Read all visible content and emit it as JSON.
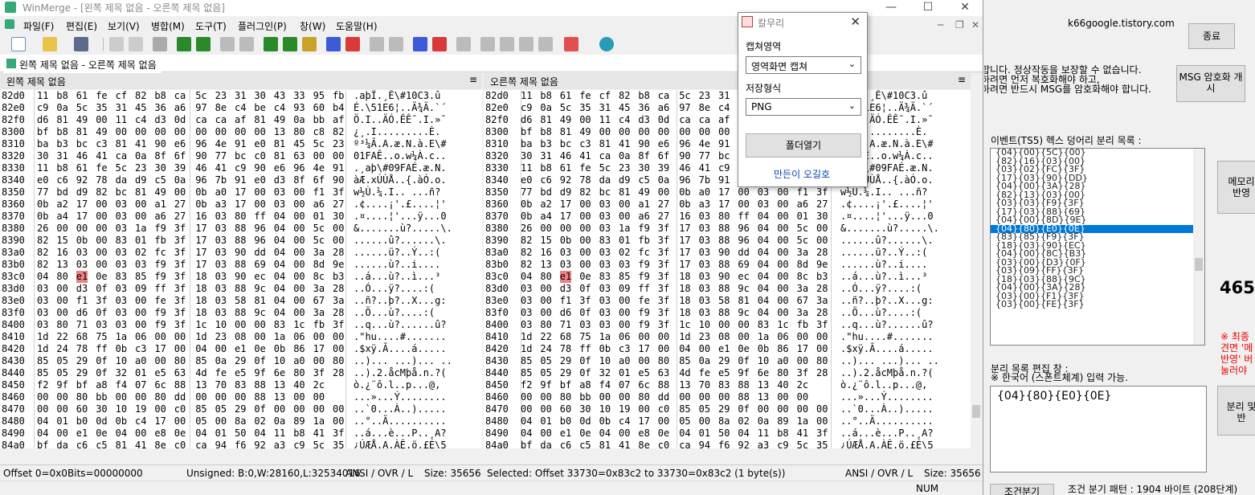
{
  "window": {
    "title": "WinMerge - [왼쪽 제목 없음 - 오른쪽 제목 없음]",
    "controls": [
      "—",
      "☐",
      "✕"
    ]
  },
  "menu": [
    "파일(F)",
    "편집(E)",
    "보기(V)",
    "병합(M)",
    "도구(T)",
    "플러그인(P)",
    "창(W)",
    "도움말(H)"
  ],
  "doc_tab": "왼쪽 제목 없음 - 오른쪽 제목 없음",
  "left_pane": {
    "header": "왼쪽 제목 없음",
    "dots": "≡"
  },
  "right_pane": {
    "header": "오른쪽 제목 없음",
    "dots": "≡"
  },
  "hex_rows": [
    {
      "off": "82d0",
      "bytes": [
        "11",
        "b8",
        "61",
        "fe",
        "cf",
        "82",
        "b8",
        "ca",
        "5c",
        "23",
        "31",
        "30",
        "43",
        "33",
        "95",
        "fb"
      ],
      "ascii": ".aþÏ.¸Ê\\#10C3.û"
    },
    {
      "off": "82e0",
      "bytes": [
        "c9",
        "0a",
        "5c",
        "35",
        "31",
        "45",
        "36",
        "a6",
        "97",
        "8e",
        "c4",
        "be",
        "c4",
        "93",
        "60",
        "b4"
      ],
      "ascii": "É.\\51E6¦..Ä¾Ä.`´"
    },
    {
      "off": "82f0",
      "bytes": [
        "d6",
        "81",
        "49",
        "00",
        "11",
        "c4",
        "d3",
        "0d",
        "ca",
        "ca",
        "af",
        "81",
        "49",
        "0a",
        "bb",
        "af"
      ],
      "ascii": "Ö.I..ÄÓ.ÊÊ¯.I.»¯"
    },
    {
      "off": "8300",
      "bytes": [
        "bf",
        "b8",
        "81",
        "49",
        "00",
        "00",
        "00",
        "00",
        "00",
        "00",
        "00",
        "00",
        "13",
        "80",
        "c8",
        "82"
      ],
      "ascii": "¿¸.I.........È."
    },
    {
      "off": "8310",
      "bays": "",
      "bytes": [
        "ba",
        "b3",
        "bc",
        "c3",
        "81",
        "41",
        "90",
        "e6",
        "96",
        "4e",
        "91",
        "e0",
        "81",
        "45",
        "5c",
        "23"
      ],
      "ascii": "º³¼Ã.A.æ.N.à.E\\#"
    },
    {
      "off": "8320",
      "bytes": [
        "30",
        "31",
        "46",
        "41",
        "ca",
        "0a",
        "8f",
        "6f",
        "90",
        "77",
        "bc",
        "c0",
        "81",
        "63",
        "00",
        "00"
      ],
      "ascii": "01FAÊ..o.w¼À.c.."
    },
    {
      "off": "8330",
      "bytes": [
        "11",
        "b8",
        "61",
        "fe",
        "5c",
        "23",
        "30",
        "39",
        "46",
        "41",
        "c9",
        "90",
        "e6",
        "96",
        "4e",
        "91"
      ],
      "ascii": ".¸aþ\\#09FAÉ.æ.N."
    },
    {
      "off": "8340",
      "bytes": [
        "e0",
        "c6",
        "92",
        "78",
        "da",
        "d9",
        "c5",
        "0a",
        "96",
        "7b",
        "91",
        "e0",
        "d3",
        "8f",
        "6f",
        "90"
      ],
      "ascii": "àÆ.xÚÙÅ..{.àÓ.o."
    },
    {
      "off": "8350",
      "bytes": [
        "77",
        "bd",
        "d9",
        "82",
        "bc",
        "81",
        "49",
        "00",
        "0b",
        "a0",
        "17",
        "00",
        "03",
        "00",
        "f1",
        "3f"
      ],
      "ascii": "w½Ù.¼.I.. ...ñ?"
    },
    {
      "off": "8360",
      "bytes": [
        "0b",
        "a2",
        "17",
        "00",
        "03",
        "00",
        "a1",
        "27",
        "0b",
        "a3",
        "17",
        "00",
        "03",
        "00",
        "a6",
        "27"
      ],
      "ascii": ".¢....¡'.£....¦'"
    },
    {
      "off": "8370",
      "bytes": [
        "0b",
        "a4",
        "17",
        "00",
        "03",
        "00",
        "a6",
        "27",
        "16",
        "03",
        "80",
        "ff",
        "04",
        "00",
        "01",
        "30"
      ],
      "ascii": ".¤....¦'...ÿ...0"
    },
    {
      "off": "8380",
      "bytes": [
        "26",
        "00",
        "00",
        "00",
        "03",
        "1a",
        "f9",
        "3f",
        "17",
        "03",
        "88",
        "96",
        "04",
        "00",
        "5c",
        "00"
      ],
      "ascii": "&.......ù?.....\\."
    },
    {
      "off": "8390",
      "bytes": [
        "82",
        "15",
        "0b",
        "00",
        "83",
        "01",
        "fb",
        "3f",
        "17",
        "03",
        "88",
        "96",
        "04",
        "00",
        "5c",
        "00"
      ],
      "ascii": "......û?......\\."
    },
    {
      "off": "83a0",
      "bytes": [
        "82",
        "16",
        "03",
        "00",
        "03",
        "02",
        "fc",
        "3f",
        "17",
        "03",
        "90",
        "dd",
        "04",
        "00",
        "3a",
        "28"
      ],
      "ascii": "......ü?..Ý..:("
    },
    {
      "off": "83b0",
      "bytes": [
        "82",
        "13",
        "03",
        "00",
        "03",
        "03",
        "f9",
        "3f",
        "17",
        "03",
        "88",
        "69",
        "04",
        "00",
        "8d",
        "9e"
      ],
      "ascii": "......ù?..i...."
    },
    {
      "off": "83c0",
      "bytes": [
        "04",
        "80",
        "e1",
        "0e",
        "83",
        "85",
        "f9",
        "3f",
        "18",
        "03",
        "90",
        "ec",
        "04",
        "00",
        "8c",
        "b3"
      ],
      "ascii": "..á...ù?..ì...³"
    },
    {
      "off": "83d0",
      "bytes": [
        "03",
        "00",
        "d3",
        "0f",
        "03",
        "09",
        "ff",
        "3f",
        "18",
        "03",
        "88",
        "9c",
        "04",
        "00",
        "3a",
        "28"
      ],
      "ascii": "..Ó...ÿ?....:("
    },
    {
      "off": "83e0",
      "bytes": [
        "03",
        "00",
        "f1",
        "3f",
        "03",
        "00",
        "fe",
        "3f",
        "18",
        "03",
        "58",
        "81",
        "04",
        "00",
        "67",
        "3a"
      ],
      "ascii": "..ñ?..þ?..X...g:"
    },
    {
      "off": "83f0",
      "bytes": [
        "03",
        "00",
        "d6",
        "0f",
        "03",
        "00",
        "f9",
        "3f",
        "18",
        "03",
        "88",
        "9c",
        "04",
        "00",
        "3a",
        "28"
      ],
      "ascii": "..Ö...ù?....:("
    },
    {
      "off": "8400",
      "bytes": [
        "03",
        "80",
        "71",
        "03",
        "03",
        "00",
        "f9",
        "3f",
        "1c",
        "10",
        "00",
        "00",
        "83",
        "1c",
        "fb",
        "3f"
      ],
      "ascii": "..q...ù?......û?"
    },
    {
      "off": "8410",
      "bytes": [
        "1d",
        "22",
        "68",
        "75",
        "1a",
        "06",
        "00",
        "00",
        "1d",
        "23",
        "08",
        "00",
        "1a",
        "06",
        "00",
        "00"
      ],
      "ascii": ".\"hu....#......."
    },
    {
      "off": "8420",
      "bytes": [
        "1d",
        "24",
        "78",
        "ff",
        "0b",
        "c3",
        "17",
        "00",
        "04",
        "00",
        "e1",
        "0e",
        "0b",
        "86",
        "17",
        "00"
      ],
      "ascii": ".$xÿ.Ã....á....."
    },
    {
      "off": "8430",
      "bytes": [
        "85",
        "05",
        "29",
        "0f",
        "10",
        "a0",
        "00",
        "80",
        "85",
        "0a",
        "29",
        "0f",
        "10",
        "a0",
        "00",
        "80"
      ],
      "ascii": "..)... ...)... .."
    },
    {
      "off": "8440",
      "bytes": [
        "85",
        "05",
        "29",
        "0f",
        "32",
        "01",
        "e5",
        "63",
        "4d",
        "fe",
        "e5",
        "9f",
        "6e",
        "80",
        "3f",
        "28"
      ],
      "ascii": "..).2.åcMþå.n.?("
    },
    {
      "off": "8450",
      "bytes": [
        "f2",
        "9f",
        "bf",
        "a8",
        "f4",
        "07",
        "6c",
        "88",
        "13",
        "70",
        "83",
        "88",
        "13",
        "40",
        "2c"
      ],
      "ascii": "ò.¿¨ô.l..p...@,"
    },
    {
      "off": "8460",
      "bytes": [
        "00",
        "00",
        "80",
        "bb",
        "00",
        "00",
        "80",
        "dd",
        "00",
        "00",
        "00",
        "88",
        "13",
        "00",
        "00"
      ],
      "ascii": "...»...Ý........"
    },
    {
      "off": "8470",
      "bytes": [
        "00",
        "00",
        "60",
        "30",
        "10",
        "19",
        "00",
        "c0",
        "85",
        "05",
        "29",
        "0f",
        "00",
        "00",
        "00",
        "00"
      ],
      "ascii": "..`0...À..)....."
    },
    {
      "off": "8480",
      "bytes": [
        "04",
        "01",
        "b0",
        "0d",
        "0b",
        "c4",
        "17",
        "00",
        "05",
        "00",
        "8a",
        "02",
        "0a",
        "89",
        "1a",
        "00"
      ],
      "ascii": "..°..Ä.........."
    },
    {
      "off": "8490",
      "bytes": [
        "04",
        "00",
        "e1",
        "0e",
        "04",
        "00",
        "e8",
        "0e",
        "04",
        "01",
        "50",
        "04",
        "11",
        "b8",
        "41",
        "3f"
      ],
      "ascii": "..á...è...P..¸A?"
    },
    {
      "off": "84a0",
      "bytes": [
        "bf",
        "da",
        "c6",
        "c5",
        "81",
        "41",
        "8e",
        "c0",
        "ca",
        "94",
        "f6",
        "92",
        "a3",
        "c9",
        "5c",
        "35"
      ],
      "ascii": "¿ÚÆÅ.A.ÀÊ.ö.£É\\5"
    }
  ],
  "status_left": {
    "offset": "Offset 0=0x0",
    "bits": "Bits=00000000",
    "unsigned": "Unsigned: B:0,W:28160,L:32534016",
    "enc": "ANSI / OVR / L",
    "size": "Size: 35656"
  },
  "status_right": {
    "selected": "Selected: Offset 33730=0x83c2 to 33730=0x83c2 (1 byte(s))",
    "enc": "ANSI / OVR / L",
    "size": "Size: 35656"
  },
  "status_num": "NUM",
  "capture": {
    "title": "칼무리",
    "area_label": "캡쳐영역",
    "area_value": "영역화면 캡쳐",
    "format_label": "저장형식",
    "format_value": "PNG",
    "open_folder": "폴더열기",
    "author_link": "만든이 오길호"
  },
  "rightapp": {
    "blog": "k66google.tistory.com",
    "close_btn": "종료",
    "msg_encrypt_btn": "MSG 암호화 개시",
    "warn1": "합니다. 정상작동을 보장할 수 없습니다.",
    "warn2": "하려면 먼저 복호화해야 하고,",
    "warn3": "하려면 반드시 MSG를 암호화해야 합니다.",
    "list_label": "이벤트(TS5) 헥스 덩어리 분리 목록 :",
    "list_items": [
      "{04}{00}{5C}{00}",
      "{82}{16}{03}{00}",
      "{03}{02}{FC}{3F}",
      "{17}{03}{90}{DD}",
      "{04}{00}{3A}{28}",
      "{82}{13}{03}{00}",
      "{03}{03}{F9}{3F}",
      "{17}{03}{88}{69}",
      "{04}{00}{8D}{9E}",
      "{04}{80}{E0}{0E}",
      "{83}{85}{F9}{3F}",
      "{18}{03}{90}{EC}",
      "{04}{00}{8C}{B3}",
      "{03}{00}{D3}{0F}",
      "{03}{09}{FF}{3F}",
      "{18}{03}{88}{9C}",
      "{04}{00}{3A}{28}",
      "{03}{00}{F1}{3F}",
      "{03}{00}{FE}{3F}"
    ],
    "selected_index": 9,
    "memory_btn": "메모리\n반영",
    "count": "465",
    "red_note": "※ 최종\n견면 '메\n반영' 버\n눌러야",
    "edit_label": "분리 목록 편집 창 :",
    "edit_note": "※ 한국어 (스폰트체계) 입력 가능.",
    "edit_value": "{04}{80}{E0}{0E}",
    "split_btn": "분리 및\n반",
    "condition": "조건 분기 패턴 : 1904 바이트 (208단계)",
    "bottom_btn": "조건분기"
  }
}
